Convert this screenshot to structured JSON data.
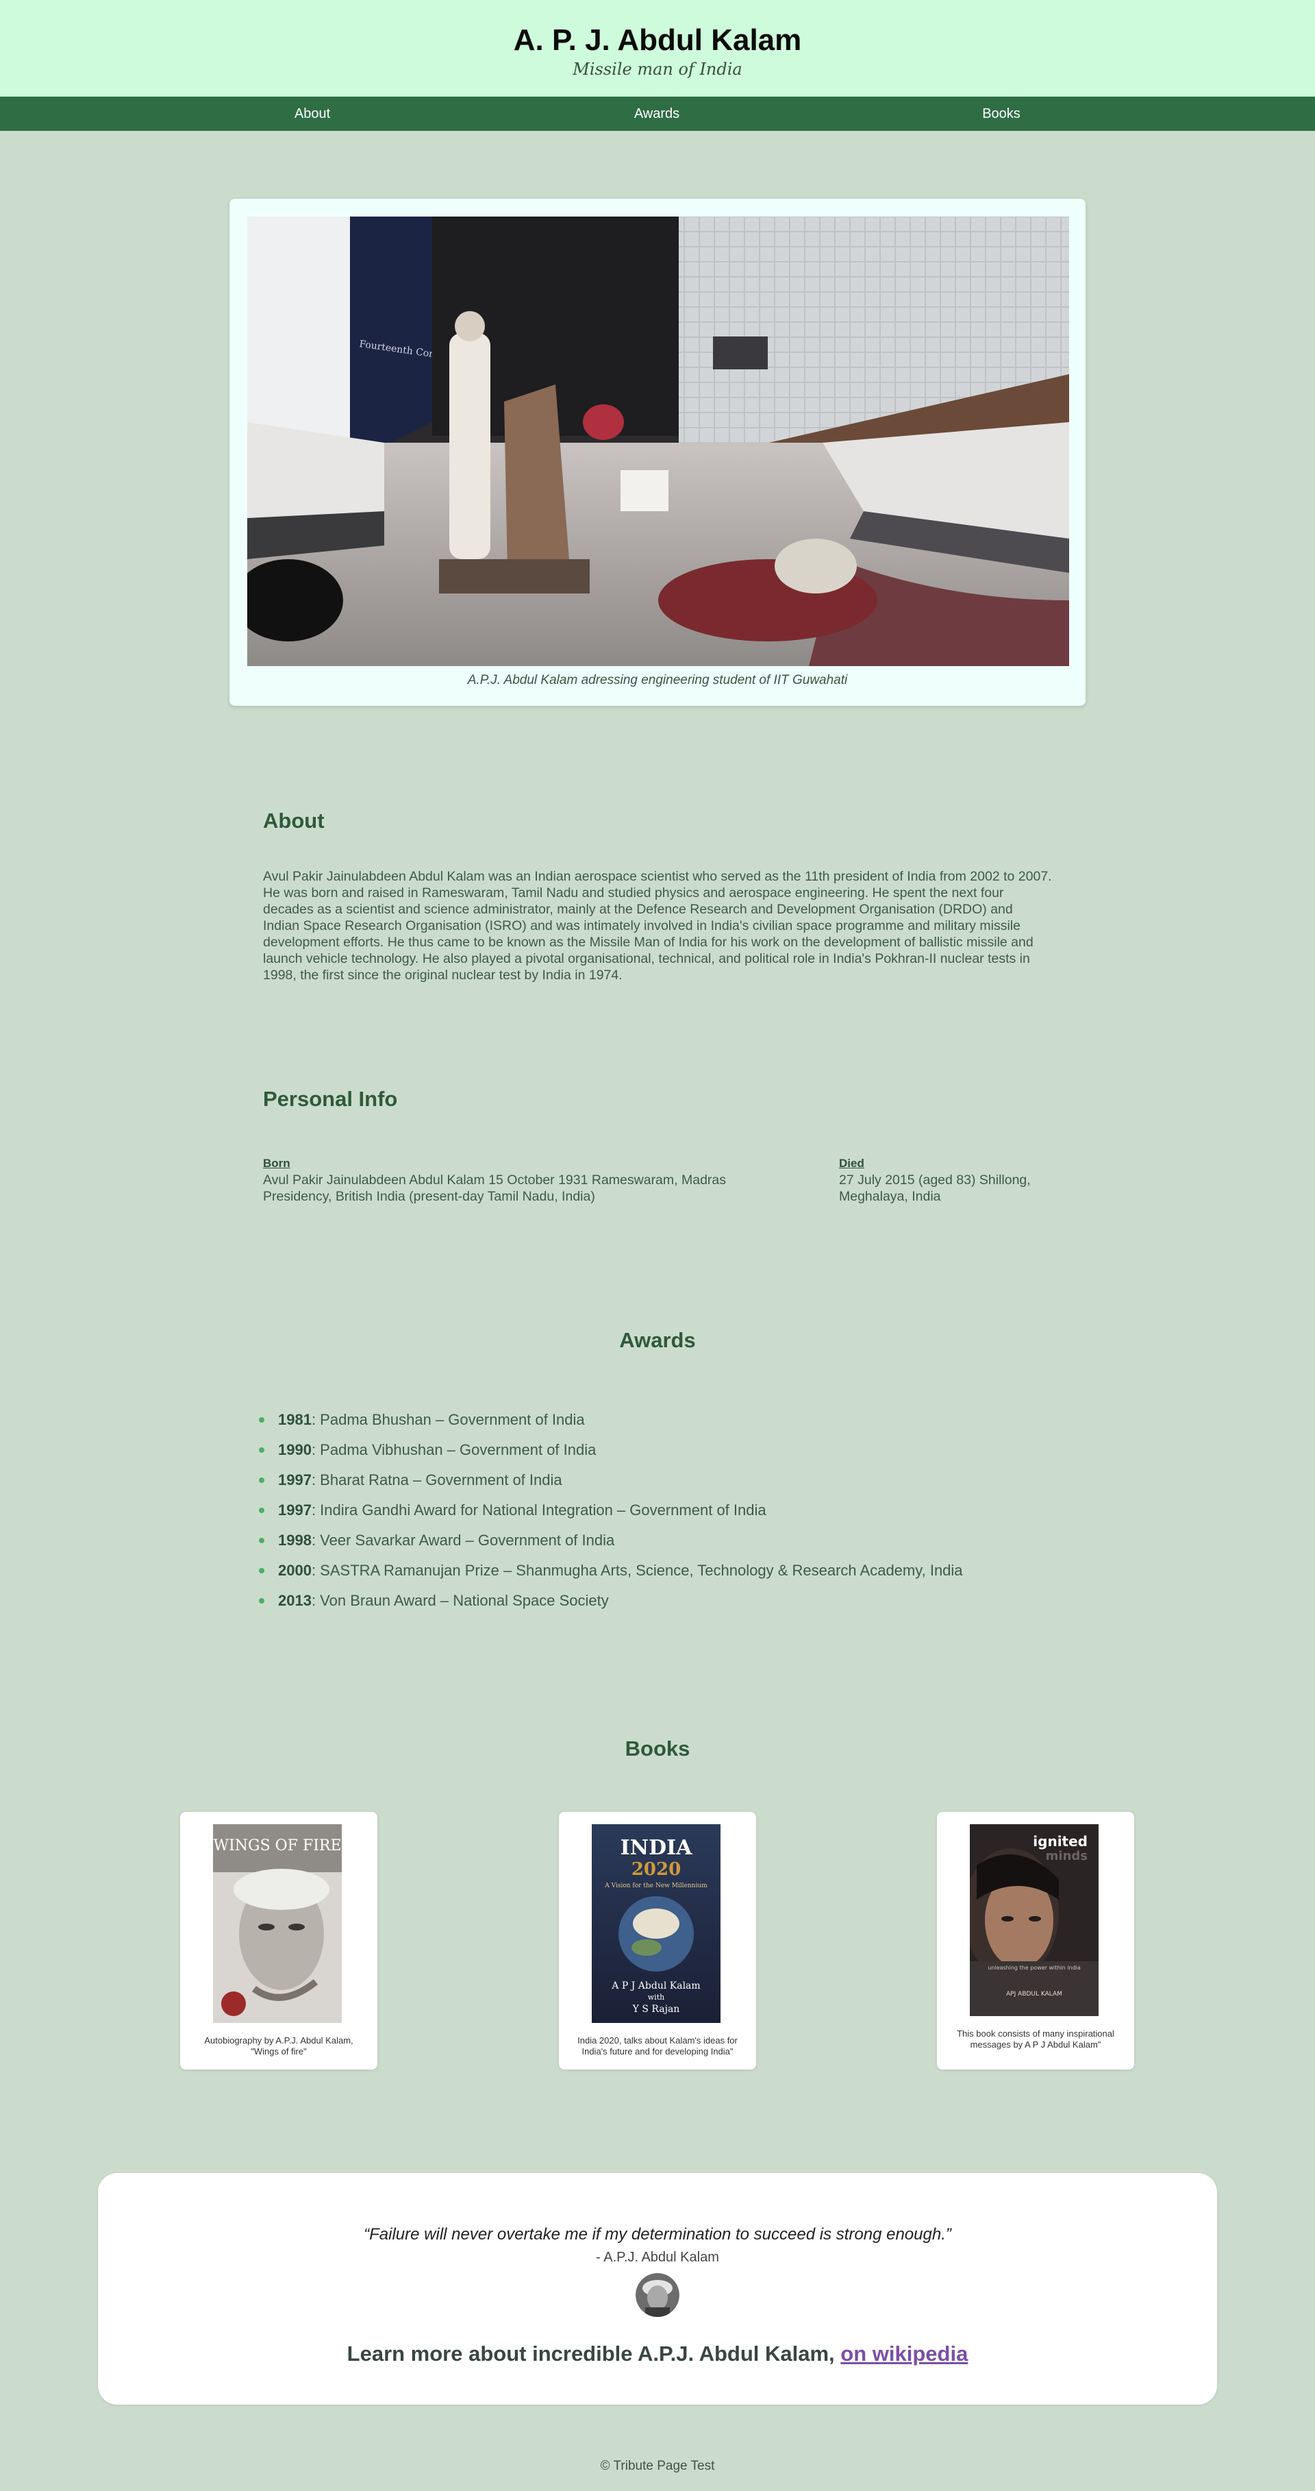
{
  "header": {
    "title": "A. P. J. Abdul Kalam",
    "subtitle": "Missile man of India"
  },
  "nav": {
    "items": [
      {
        "label": "About"
      },
      {
        "label": "Awards"
      },
      {
        "label": "Books"
      }
    ]
  },
  "hero": {
    "caption": "A.P.J. Abdul Kalam adressing engineering student of IIT Guwahati",
    "banner_title": "Fourteenth Convocation"
  },
  "about": {
    "heading": "About",
    "text": "Avul Pakir Jainulabdeen Abdul Kalam was an Indian aerospace scientist who served as the 11th president of India from 2002 to 2007. He was born and raised in Rameswaram, Tamil Nadu and studied physics and aerospace engineering. He spent the next four decades as a scientist and science administrator, mainly at the Defence Research and Development Organisation (DRDO) and Indian Space Research Organisation (ISRO) and was intimately involved in India's civilian space programme and military missile development efforts. He thus came to be known as the Missile Man of India for his work on the development of ballistic missile and launch vehicle technology. He also played a pivotal organisational, technical, and political role in India's Pokhran-II nuclear tests in 1998, the first since the original nuclear test by India in 1974."
  },
  "personal_info": {
    "heading": "Personal Info",
    "born_label": "Born",
    "born_value": "Avul Pakir Jainulabdeen Abdul Kalam 15 October 1931 Rameswaram, Madras Presidency, British India (present-day Tamil Nadu, India)",
    "died_label": "Died",
    "died_value": "27 July 2015 (aged 83) Shillong, Meghalaya, India"
  },
  "awards": {
    "heading": "Awards",
    "items": [
      {
        "year": "1981",
        "text": ": Padma Bhushan – Government of India"
      },
      {
        "year": "1990",
        "text": ": Padma Vibhushan – Government of India"
      },
      {
        "year": "1997",
        "text": ": Bharat Ratna – Government of India"
      },
      {
        "year": "1997",
        "text": ": Indira Gandhi Award for National Integration – Government of India"
      },
      {
        "year": "1998",
        "text": ": Veer Savarkar Award – Government of India"
      },
      {
        "year": "2000",
        "text": ": SASTRA Ramanujan Prize – Shanmugha Arts, Science, Technology & Research Academy, India"
      },
      {
        "year": "2013",
        "text": ": Von Braun Award – National Space Society"
      }
    ]
  },
  "books": {
    "heading": "Books",
    "items": [
      {
        "cover_title": "WINGS OF FIRE",
        "caption": "Autobiography by A.P.J. Abdul Kalam, \"Wings of fire\""
      },
      {
        "cover_title": "INDIA",
        "cover_year": "2020",
        "cover_tagline": "A Vision for the New Millennium",
        "cover_author": "A P J Abdul Kalam",
        "cover_with": "with",
        "cover_coauthor": "Y S Rajan",
        "caption": "India 2020, talks about Kalam's ideas for India's future and for developing India\""
      },
      {
        "cover_title": "ignited",
        "cover_title2": "minds",
        "cover_tagline": "unleashing the power within india",
        "cover_author": "APJ ABDUL KALAM",
        "caption": "This book consists of many inspirational messages by A P J Abdul Kalam\""
      }
    ]
  },
  "quote": {
    "text": "“Failure will never overtake me if my determination to succeed is strong enough.”",
    "author": "- A.P.J. Abdul Kalam",
    "learn_more_prefix": "Learn more about incredible A.P.J. Abdul Kalam, ",
    "learn_more_link": "on wikipedia"
  },
  "footer": {
    "text": "© Tribute Page Test"
  }
}
